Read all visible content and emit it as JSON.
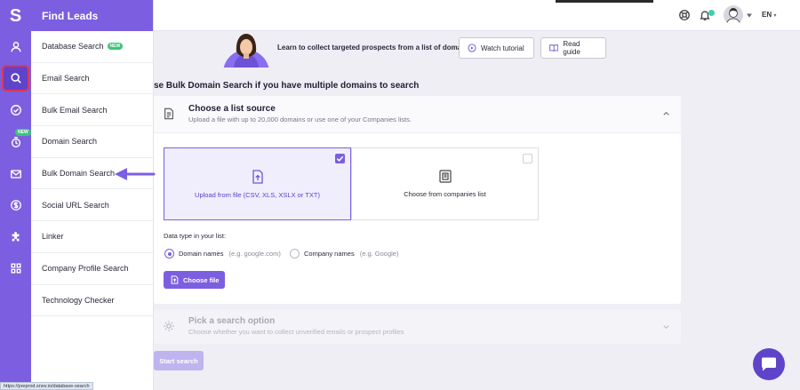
{
  "brand": {
    "logo_letter": "S"
  },
  "rail": {
    "icons": [
      "user-icon",
      "search-icon",
      "check-circle-icon",
      "drip-icon",
      "mail-icon",
      "dollar-icon",
      "puzzle-icon",
      "grid-icon"
    ],
    "new_badge": "NEW"
  },
  "flyout": {
    "title": "Find Leads",
    "items": [
      {
        "label": "Database Search",
        "badge": "NEW"
      },
      {
        "label": "Email Search"
      },
      {
        "label": "Bulk Email Search"
      },
      {
        "label": "Domain Search"
      },
      {
        "label": "Bulk Domain Search"
      },
      {
        "label": "Social URL Search"
      },
      {
        "label": "Linker"
      },
      {
        "label": "Company Profile Search"
      },
      {
        "label": "Technology Checker"
      }
    ]
  },
  "topbar": {
    "language": "EN"
  },
  "banner": {
    "text": "Learn to collect targeted prospects from a list of domains",
    "watch_label": "Watch tutorial",
    "guide_label": "Read guide"
  },
  "page": {
    "heading": "se Bulk Domain Search if you have multiple domains to search"
  },
  "step1": {
    "title": "Choose a list source",
    "subtitle": "Upload a file with up to 20,000 domains or use one of your Companies lists.",
    "upload_label": "Upload from file (CSV, XLS, XSLX or TXT)",
    "companies_label": "Choose from companies list",
    "data_type_label": "Data type in your list:",
    "radio_domain_label": "Domain names",
    "radio_domain_hint": "(e.g. google.com)",
    "radio_company_label": "Company names",
    "radio_company_hint": "(e.g. Google)",
    "choose_file_label": "Choose file"
  },
  "step2": {
    "title": "Pick a search option",
    "subtitle": "Choose whether you want to collect unverified emails or prospect profiles"
  },
  "start_label": "Start search",
  "status_url": "https://preprod.snov.io/database-search",
  "colors": {
    "accent": "#7b5fe0",
    "badge": "#3cc47c",
    "highlight": "#e1365a"
  }
}
